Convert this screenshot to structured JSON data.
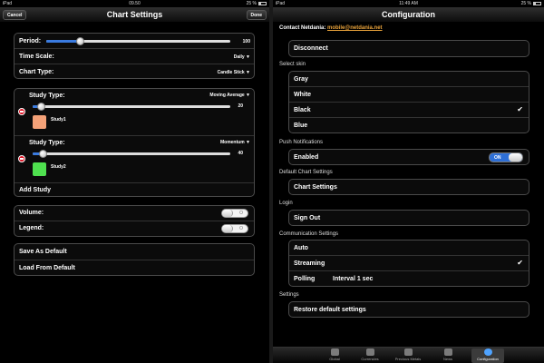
{
  "left": {
    "status": {
      "carrier": "iPad",
      "time": "09.50",
      "battery": "25 %"
    },
    "nav": {
      "title": "Chart Settings",
      "cancel": "Cancel",
      "done": "Done"
    },
    "period": {
      "label": "Period:",
      "value": "100",
      "fraction": 0.18
    },
    "time_scale": {
      "label": "Time Scale:",
      "value": "Daily"
    },
    "chart_type": {
      "label": "Chart Type:",
      "value": "Candle Stick"
    },
    "studies": [
      {
        "type_label": "Study Type:",
        "type_value": "Moving Average",
        "slider_value": "20",
        "fraction": 0.04,
        "name": "Study1",
        "color": "#f4a178"
      },
      {
        "type_label": "Study Type:",
        "type_value": "Momentum",
        "slider_value": "40",
        "fraction": 0.05,
        "name": "Study2",
        "color": "#4fe04f"
      }
    ],
    "add_study": "Add Study",
    "volume": {
      "label": "Volume:",
      "state": "O"
    },
    "legend": {
      "label": "Legend:",
      "state": "O"
    },
    "save_default": "Save As Default",
    "load_default": "Load From Default"
  },
  "right": {
    "status": {
      "carrier": "iPad",
      "time": "11:49 AM",
      "battery": "25 %"
    },
    "nav": {
      "title": "Configuration"
    },
    "contact_label": "Contact Netdania:",
    "contact_email": "mobile@netdania.net",
    "disconnect": "Disconnect",
    "skin_header": "Select skin",
    "skins": [
      "Gray",
      "White",
      "Black",
      "Blue"
    ],
    "push_header": "Push Notifications",
    "push_label": "Enabled",
    "push_toggle": "ON",
    "chart_header": "Default Chart Settings",
    "chart_settings": "Chart Settings",
    "login_header": "Login",
    "sign_out": "Sign Out",
    "comm_header": "Communication Settings",
    "comm_options": [
      "Auto",
      "Streaming",
      "Polling"
    ],
    "polling_interval": "Interval 1 sec",
    "settings_header": "Settings",
    "restore": "Restore default settings",
    "tabs": [
      "Global",
      "Currencies",
      "Precious Metals",
      "News",
      "Configuration"
    ]
  }
}
